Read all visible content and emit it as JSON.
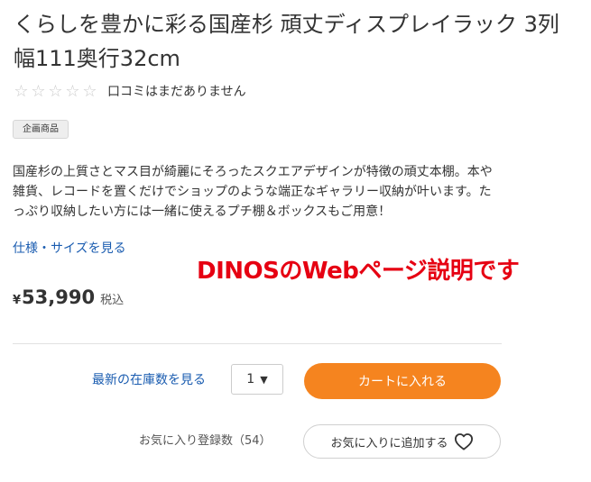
{
  "product": {
    "title": "くらしを豊かに彩る国産杉 頑丈ディスプレイラック 3列 幅111奥行32cm",
    "rating": {
      "stars": 0,
      "max_stars": 5,
      "star_glyph": "☆",
      "text": "口コミはまだありません"
    },
    "badge": "企画商品",
    "description": "国産杉の上質さとマス目が綺麗にそろったスクエアデザインが特徴の頑丈本棚。本や雑貨、レコードを置くだけでショップのような端正なギャラリー収納が叶います。たっぷり収納したい方には一緒に使えるプチ棚＆ボックスもご用意！",
    "spec_link": "仕様・サイズを見る",
    "price": {
      "currency": "¥",
      "value": "53,990",
      "tax_label": "税込"
    }
  },
  "annotation": "DINOSのWebページ説明です",
  "purchase": {
    "stock_link": "最新の在庫数を見る",
    "quantity": "1",
    "quantity_caret": "▼",
    "cart_button": "カートに入れる",
    "favorite_count_label": "お気に入り登録数（54）",
    "favorite_button": "お気に入りに追加する"
  },
  "colors": {
    "accent_orange": "#f5841f",
    "link_blue": "#1a5cb0",
    "annotation_red": "#e60012"
  },
  "icons": {
    "star": "star-outline-icon",
    "heart": "heart-outline-icon",
    "caret": "caret-down-icon"
  }
}
